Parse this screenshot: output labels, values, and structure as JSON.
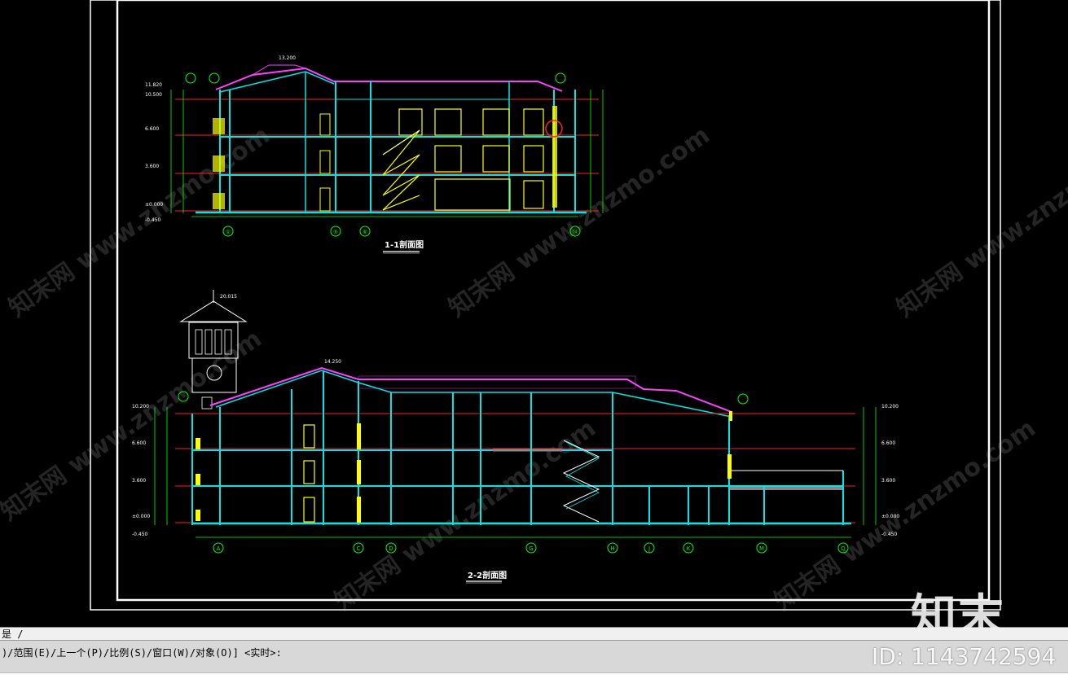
{
  "app": {
    "history_text": "是 /",
    "command_prompt": ")/范围(E)/上一个(P)/比例(S)/窗口(W)/对象(O)] <实时>:"
  },
  "drawing": {
    "section1_title": "1-1剖面图",
    "section2_title": "2-2剖面图",
    "section1_axes": [
      "①",
      "⑤",
      "⑥",
      "⑭"
    ],
    "section2_axes": [
      "A",
      "C",
      "D",
      "G",
      "H",
      "J",
      "K",
      "M",
      "Q"
    ],
    "roof_peak_level_1": "13.200",
    "roof_peak_level_2": "14.250",
    "tower_top_level": "20.015",
    "levels_left_1": [
      "11.820",
      "10.500",
      "6.600",
      "3.600",
      "±0.000",
      "-0.450"
    ],
    "levels_left_2": [
      "10.200",
      "6.600",
      "3.600",
      "±0.000",
      "-0.450"
    ],
    "levels_right_2": [
      "10.200",
      "6.600",
      "3.600",
      "±0.000",
      "-0.450"
    ]
  },
  "watermark": {
    "logo": "知末",
    "id_label": "ID: 1143742594",
    "diagonal_text": "知末网 www.znzmo.com"
  },
  "colors": {
    "canvas_bg": "#000000",
    "structure_cyan": "#00e5e5",
    "window_yellow": "#ffff00",
    "roof_magenta": "#ff40ff",
    "level_red": "#ff2020",
    "axis_green": "#00ff00",
    "frame_white": "#ffffff"
  }
}
